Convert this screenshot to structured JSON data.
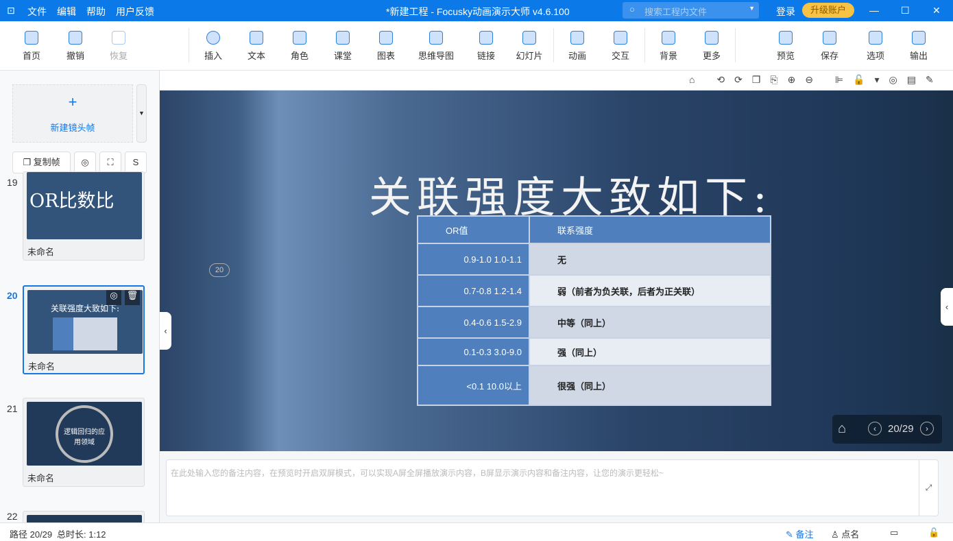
{
  "titlebar": {
    "menus": [
      "文件",
      "编辑",
      "帮助",
      "用户反馈"
    ],
    "title": "*新建工程 - Focusky动画演示大师  v4.6.100",
    "search_placeholder": "搜索工程内文件",
    "login": "登录",
    "upgrade": "升级账户"
  },
  "toolbar": {
    "items": [
      "首页",
      "撤销",
      "恢复",
      "插入",
      "文本",
      "角色",
      "课堂",
      "图表",
      "思维导图",
      "链接",
      "幻灯片",
      "动画",
      "交互",
      "背景",
      "更多",
      "预览",
      "保存",
      "选项",
      "输出"
    ]
  },
  "sidebar": {
    "new_frame": "新建镜头帧",
    "copy_frame": "复制帧",
    "frames": [
      {
        "number": "19",
        "thumb_text": "OR比数比",
        "name": "未命名"
      },
      {
        "number": "20",
        "thumb_text": "关联强度大致如下:",
        "name": "未命名"
      },
      {
        "number": "21",
        "thumb_text": "逻辑回归的应用领域",
        "name": "未命名"
      },
      {
        "number": "22"
      }
    ]
  },
  "slide": {
    "marker": "20",
    "title": "关联强度大致如下:",
    "table": {
      "headers": [
        "OR值",
        "联系强度"
      ],
      "rows": [
        [
          "0.9-1.0  1.0-1.1",
          "无"
        ],
        [
          "0.7-0.8  1.2-1.4",
          "弱（前者为负关联，后者为正关联）"
        ],
        [
          "0.4-0.6  1.5-2.9",
          "中等（同上）"
        ],
        [
          "0.1-0.3  3.0-9.0",
          "强（同上）"
        ],
        [
          "<0.1  10.0以上",
          "很强（同上）"
        ]
      ]
    },
    "page": "20/29"
  },
  "notes": {
    "placeholder": "在此处输入您的备注内容，在预览时开启双屏模式，可以实现A屏全屏播放演示内容，B屏显示演示内容和备注内容，让您的演示更轻松~"
  },
  "status": {
    "path": "路径 20/29",
    "duration": "总时长: 1:12",
    "notes": "备注",
    "rollcall": "点名"
  },
  "colors": {
    "accent": "#0b79e8",
    "upgrade": "#f8c244",
    "table_header": "#4f80bd"
  }
}
